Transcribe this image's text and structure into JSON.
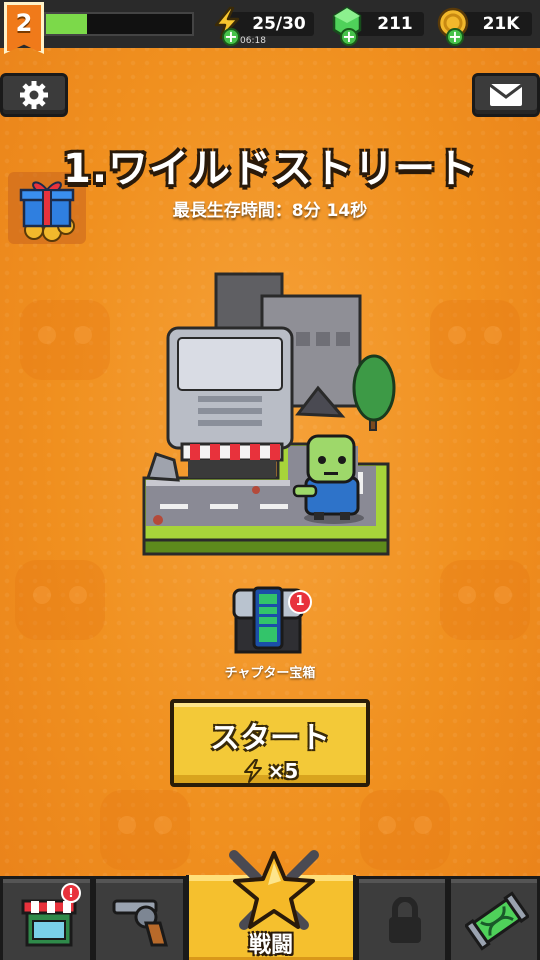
{
  "player": {
    "level": "2",
    "xp_fraction": 0.28
  },
  "resources": {
    "energy": {
      "value": "25/30",
      "timer": "06:18",
      "icon": "lightning-icon"
    },
    "gems": {
      "value": "211",
      "icon": "green-gem-icon"
    },
    "coins": {
      "value": "21K",
      "icon": "gold-coin-icon"
    }
  },
  "chapter": {
    "title": "1.ワイルドストリート",
    "best_survival": "最長生存時間：8分 14秒"
  },
  "chest": {
    "label": "チャプター宝箱",
    "badge_count": "1"
  },
  "start": {
    "label": "スタート",
    "cost": "×5"
  },
  "nav": {
    "active_label": "戦闘",
    "shop_badge": "!"
  },
  "colors": {
    "background": "#f08a1e",
    "start_button": "#f3c938",
    "active_tab": "#f5c02e",
    "xp_fill": "#7cd94a",
    "badge": "#e8323c"
  }
}
